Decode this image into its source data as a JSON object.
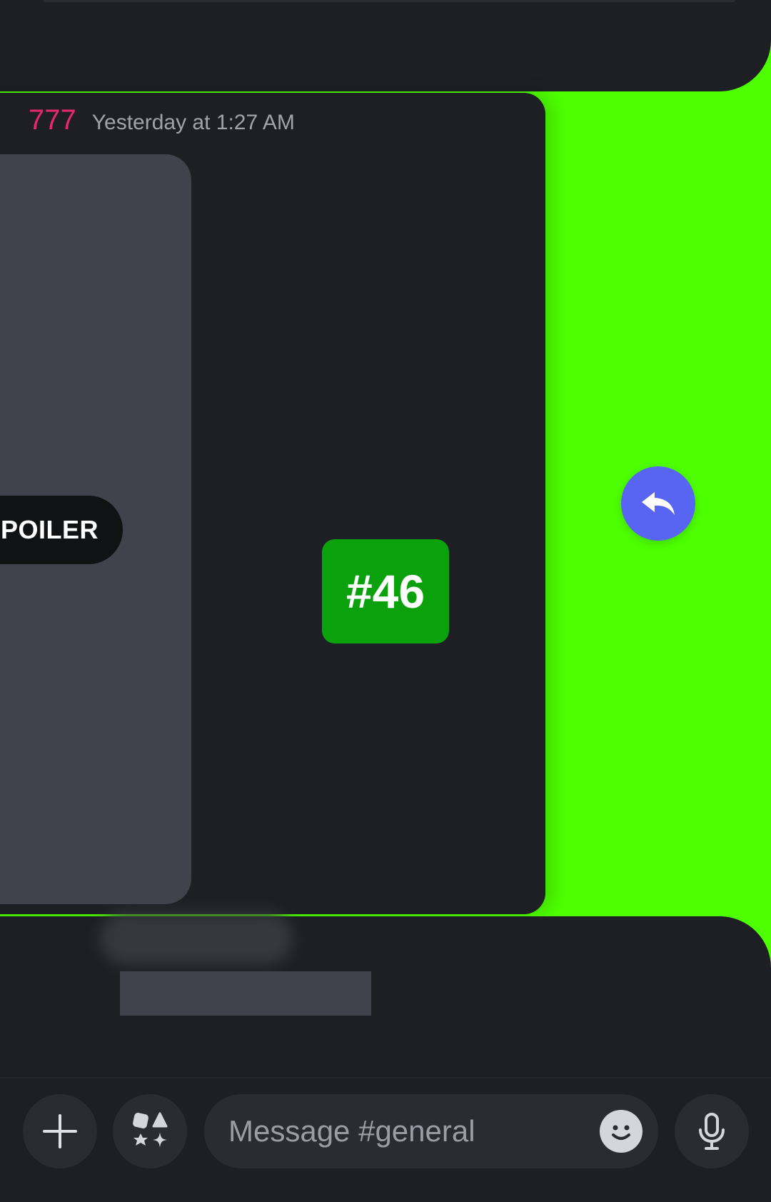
{
  "message": {
    "username": "777",
    "timestamp": "Yesterday at 1:27 AM",
    "spoiler_label": "SPOILER",
    "badge": "#46"
  },
  "composer": {
    "placeholder": "Message #general"
  },
  "icons": {
    "reply": "reply-arrow-icon",
    "add": "plus-icon",
    "apps": "apps-sparkle-icon",
    "emoji": "smiley-icon",
    "mic": "microphone-icon"
  },
  "colors": {
    "swipe_background": "#4dff00",
    "username": "#e8286d",
    "reply_button": "#5865f2",
    "badge": "#0aa10d",
    "surface": "#1e1f24"
  }
}
